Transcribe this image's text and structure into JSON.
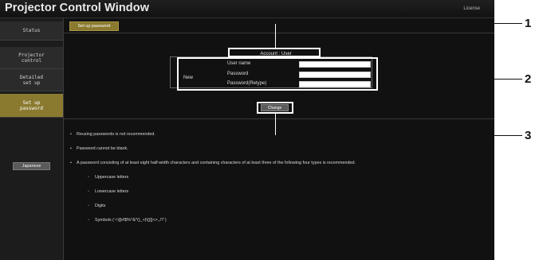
{
  "window": {
    "title": "Projector Control Window",
    "license": "License"
  },
  "sidebar": {
    "items": [
      {
        "label": "Status"
      },
      {
        "label": "Projector\ncontrol"
      },
      {
        "label": "Detailed\nset up"
      },
      {
        "label": "Set up\npassword",
        "active": true
      }
    ],
    "language_button": "Japanese"
  },
  "main": {
    "tab_label": "Set up password",
    "account_label": "Account : User",
    "new_label": "New",
    "fields": [
      {
        "label": "User name",
        "value": ""
      },
      {
        "label": "Password",
        "value": ""
      },
      {
        "label": "Password(Retype)",
        "value": ""
      }
    ],
    "change_button": "Change",
    "notes": [
      "Reusing passwords is not recommended.",
      "Password cannot be blank.",
      "A password consisting of at least eight half-width characters and containing characters of at least three of the following four types is recommended."
    ],
    "char_types": [
      "Uppercase letters",
      "Lowercase letters",
      "Digits",
      "Symbols (~!@#$%^&*()_+|\\{}[]<>.,/?`)"
    ]
  },
  "callouts": [
    "1",
    "2",
    "3"
  ],
  "colors": {
    "accent": "#8a7a2f",
    "background": "#111111"
  }
}
